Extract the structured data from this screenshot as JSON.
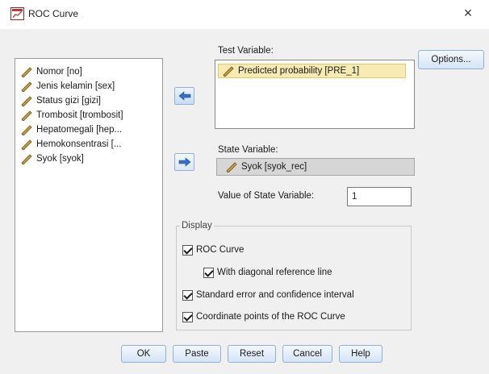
{
  "window": {
    "title": "ROC Curve",
    "close_glyph": "×"
  },
  "source_list": {
    "items": [
      "Nomor [no]",
      "Jenis kelamin [sex]",
      "Status gizi [gizi]",
      "Trombosit [trombosit]",
      "Hepatomegali [hep...",
      "Hemokonsentrasi [...",
      "Syok [syok]"
    ]
  },
  "test_variable": {
    "label": "Test Variable:",
    "items": [
      "Predicted probability [PRE_1]"
    ]
  },
  "state_variable": {
    "label": "State Variable:",
    "value": "Syok [syok_rec]"
  },
  "value_of_state": {
    "label": "Value of State Variable:",
    "value": "1"
  },
  "options_button": "Options...",
  "display": {
    "legend": "Display",
    "roc_curve": {
      "label": "ROC Curve",
      "checked": true
    },
    "diagonal": {
      "label": "With diagonal reference line",
      "checked": true
    },
    "std_error": {
      "label": "Standard error and confidence interval",
      "checked": true
    },
    "coordinates": {
      "label": "Coordinate points of the ROC Curve",
      "checked": true
    }
  },
  "buttons": {
    "ok": "OK",
    "paste": "Paste",
    "reset": "Reset",
    "cancel": "Cancel",
    "help": "Help"
  },
  "icons": {
    "app": "roc-chart-icon",
    "variable": "pencil-scale-icon",
    "move_test": "arrow-left-icon",
    "move_state": "arrow-right-icon",
    "accent": "#3a6fc4"
  }
}
